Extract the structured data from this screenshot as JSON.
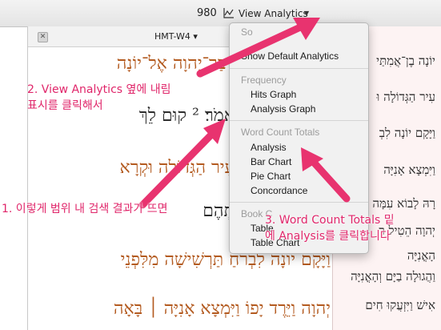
{
  "toolbar": {
    "count": "980",
    "analytics_label": "View Analytics",
    "analytics_icon": "line-graph-icon",
    "caret_icon": "chevron-down-icon"
  },
  "pane": {
    "resource": "HMT-W4",
    "resource_caret": "▾",
    "close_icon": "close-icon",
    "hebrew_lines": [
      "דְבַר־יְהוָה אֶל־יוֹנָה",
      "ֵאמֹר׃ ² קוּם לֵךְ",
      "ָעִיר הַגְּדוֹלָה וּקְרָא",
      "ִתְהֶם",
      "ֹוַיָּקָם יוֹנָה לִבְרֹחַ תַּרְשִׁישָׁה מִלִּפְנֵי",
      "יְהוָה וַיֵּרֶד יָפוֹ וַיִּמְצָא אָנִיָּה ׀ בָּאָה"
    ],
    "hebrew_sup": "2"
  },
  "right_pane": {
    "lines": [
      "יוֹנָה בֶן־אֲמִתַּי",
      "עִיר הַגְּדוֹלָה וּ",
      "וַיָּקָם יוֹנָה לִבְ",
      "וַיִּמְצָא אָנִיָּה",
      "רָהּ לָבוֹא עִמָּה",
      "יְהוָה הֵטִיל ר",
      "הָאֳנִיָּה",
      "וַהֲגוּלָה בַיָּם וְהָאֳנִיָּה",
      "אִישׁ וַיִּזְעֲקוּ חִים"
    ]
  },
  "menu": {
    "header_top": "So",
    "show_default": "Show Default Analytics",
    "frequency_header": "Frequency",
    "hits_graph": "Hits Graph",
    "analysis_graph": "Analysis Graph",
    "wct_header": "Word Count Totals",
    "analysis": "Analysis",
    "bar_chart": "Bar Chart",
    "pie_chart": "Pie Chart",
    "concordance": "Concordance",
    "book_header": "Book C",
    "table": "Table",
    "table_chart": "Table Chart"
  },
  "annotations": {
    "step1": "1. 이렇게 범위 내 검색 결과가 뜨면",
    "step2_line1": "2. View Analytics 옆에 내림",
    "step2_line2": "표시를 클릭해서",
    "step3_line1": "3. Word Count Totals 밑",
    "step3_line2": "에 Analysis를 클릭합니다",
    "color": "#e0266a"
  },
  "colors": {
    "hebrew_accent": "#b35a1f",
    "right_pane_bg": "#fdf3f3",
    "menu_bg": "#f1f1f1"
  }
}
